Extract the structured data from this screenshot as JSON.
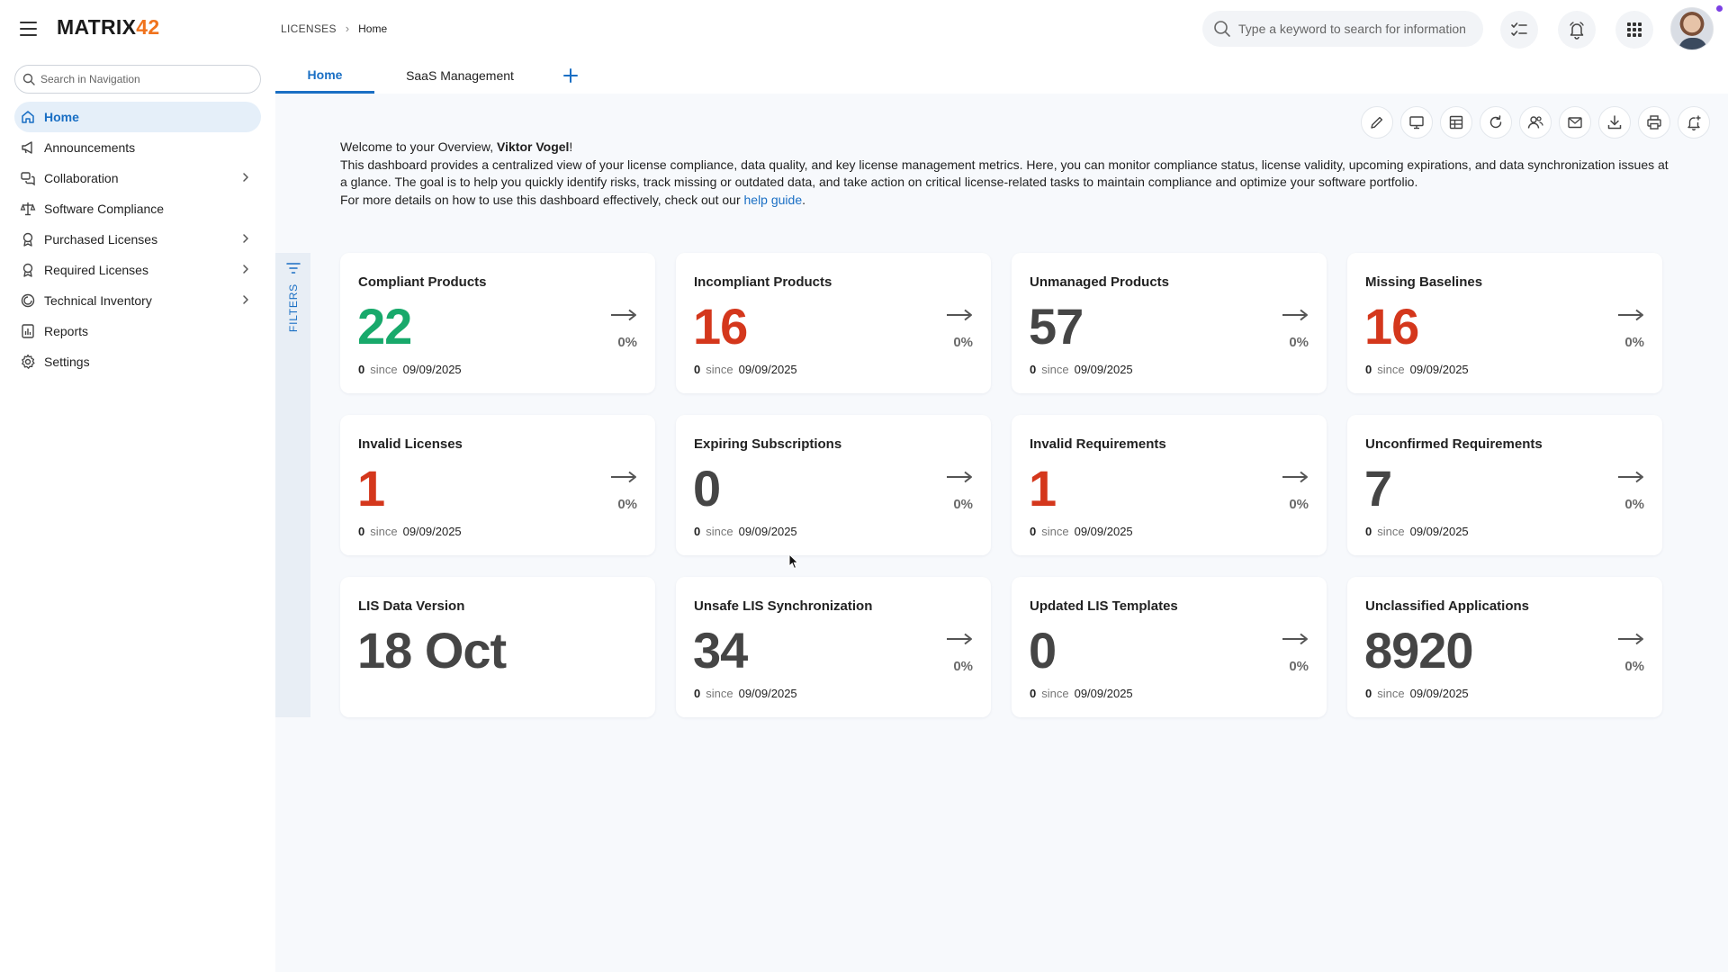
{
  "app": {
    "logo_main": "MATRIX",
    "logo_accent": "42",
    "breadcrumb": [
      "LICENSES",
      "Home"
    ]
  },
  "header": {
    "search_placeholder": "Type a keyword to search for information",
    "icons": [
      "tasks-icon",
      "bell-icon",
      "apps-grid-icon"
    ]
  },
  "sidebar": {
    "search_placeholder": "Search in Navigation",
    "items": [
      {
        "label": "Home",
        "icon": "home-icon",
        "active": true,
        "expandable": false
      },
      {
        "label": "Announcements",
        "icon": "megaphone-icon",
        "active": false,
        "expandable": false
      },
      {
        "label": "Collaboration",
        "icon": "collaboration-icon",
        "active": false,
        "expandable": true
      },
      {
        "label": "Software Compliance",
        "icon": "scale-icon",
        "active": false,
        "expandable": false
      },
      {
        "label": "Purchased Licenses",
        "icon": "badge-icon",
        "active": false,
        "expandable": true
      },
      {
        "label": "Required Licenses",
        "icon": "badge-icon",
        "active": false,
        "expandable": true
      },
      {
        "label": "Technical Inventory",
        "icon": "inventory-icon",
        "active": false,
        "expandable": true
      },
      {
        "label": "Reports",
        "icon": "report-icon",
        "active": false,
        "expandable": false
      },
      {
        "label": "Settings",
        "icon": "gear-icon",
        "active": false,
        "expandable": false
      }
    ]
  },
  "tabs": [
    {
      "label": "Home",
      "active": true
    },
    {
      "label": "SaaS Management",
      "active": false
    }
  ],
  "welcome": {
    "greeting_prefix": "Welcome to your Overview, ",
    "user_name": "Viktor Vogel",
    "greeting_suffix": "!",
    "description": "This dashboard provides a centralized view of your license compliance, data quality, and key license management metrics. Here, you can monitor compliance status, license validity, upcoming expirations, and data synchronization issues at a glance. The goal is to help you quickly identify risks, track missing or outdated data, and take action on critical license-related tasks to maintain compliance and optimize your software portfolio.",
    "help_prefix": "For more details on how to use this dashboard effectively, check out our ",
    "help_link": "help guide",
    "help_suffix": "."
  },
  "filters_label": "FILTERS",
  "colors": {
    "accent": "#1a6fc4",
    "good": "#18a96b",
    "bad": "#d4371c",
    "neutral": "#454545",
    "brand_orange": "#f0731d"
  },
  "cards": [
    {
      "title": "Compliant Products",
      "value": "22",
      "tone": "green",
      "pct": "0%",
      "delta": "0",
      "since": "since",
      "date": "09/09/2025"
    },
    {
      "title": "Incompliant Products",
      "value": "16",
      "tone": "red",
      "pct": "0%",
      "delta": "0",
      "since": "since",
      "date": "09/09/2025"
    },
    {
      "title": "Unmanaged Products",
      "value": "57",
      "tone": "gray",
      "pct": "0%",
      "delta": "0",
      "since": "since",
      "date": "09/09/2025"
    },
    {
      "title": "Missing Baselines",
      "value": "16",
      "tone": "red",
      "pct": "0%",
      "delta": "0",
      "since": "since",
      "date": "09/09/2025"
    },
    {
      "title": "Invalid Licenses",
      "value": "1",
      "tone": "red",
      "pct": "0%",
      "delta": "0",
      "since": "since",
      "date": "09/09/2025"
    },
    {
      "title": "Expiring Subscriptions",
      "value": "0",
      "tone": "gray",
      "pct": "0%",
      "delta": "0",
      "since": "since",
      "date": "09/09/2025"
    },
    {
      "title": "Invalid Requirements",
      "value": "1",
      "tone": "red",
      "pct": "0%",
      "delta": "0",
      "since": "since",
      "date": "09/09/2025"
    },
    {
      "title": "Unconfirmed Requirements",
      "value": "7",
      "tone": "gray",
      "pct": "0%",
      "delta": "0",
      "since": "since",
      "date": "09/09/2025"
    },
    {
      "title": "LIS Data Version",
      "value": "18 Oct",
      "tone": "gray",
      "pct": "",
      "delta": "",
      "since": "",
      "date": ""
    },
    {
      "title": "Unsafe LIS Synchronization",
      "value": "34",
      "tone": "gray",
      "pct": "0%",
      "delta": "0",
      "since": "since",
      "date": "09/09/2025"
    },
    {
      "title": "Updated LIS Templates",
      "value": "0",
      "tone": "gray",
      "pct": "0%",
      "delta": "0",
      "since": "since",
      "date": "09/09/2025"
    },
    {
      "title": "Unclassified Applications",
      "value": "8920",
      "tone": "gray",
      "pct": "0%",
      "delta": "0",
      "since": "since",
      "date": "09/09/2025"
    }
  ],
  "toolbar": [
    "edit-icon",
    "monitor-icon",
    "layout-icon",
    "refresh-icon",
    "share-users-icon",
    "mail-icon",
    "download-icon",
    "print-icon",
    "add-alert-icon"
  ]
}
